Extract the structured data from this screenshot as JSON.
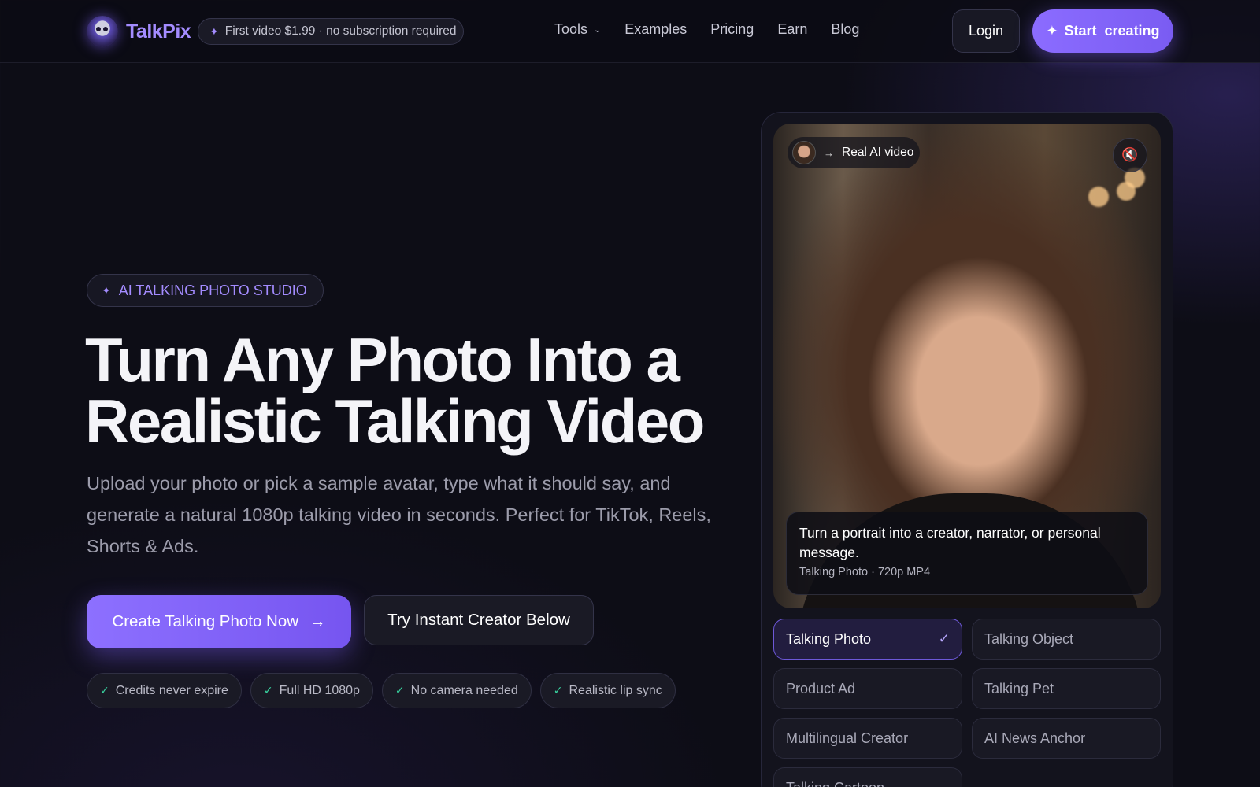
{
  "nav": {
    "brand": "TalkPix",
    "promo": "First video $1.99 · no subscription required",
    "menu": [
      {
        "label": "Tools"
      },
      {
        "label": "Examples"
      },
      {
        "label": "Pricing"
      },
      {
        "label": "Earn"
      },
      {
        "label": "Blog"
      }
    ],
    "login_label": "Login",
    "start_label": "Start  creating"
  },
  "hero": {
    "eyebrow": "AI TALKING PHOTO STUDIO",
    "title_line1": "Turn Any Photo Into a",
    "title_line2": "Realistic Talking Video",
    "subtitle": "Upload your photo or pick a sample avatar, type what it should say, and generate a natural 1080p talking video in seconds. Perfect for TikTok, Reels, Shorts & Ads.",
    "cta_primary": "Create Talking Photo Now",
    "cta_secondary": "Try Instant Creator Below",
    "features": [
      "Credits never expire",
      "Full HD 1080p",
      "No camera needed",
      "Realistic lip sync"
    ]
  },
  "preview": {
    "tag": "Real AI video",
    "caption": "Turn a portrait into a creator, narrator, or personal message.",
    "meta": "Talking Photo · 720p MP4",
    "options": [
      {
        "label": "Talking Photo",
        "selected": true
      },
      {
        "label": "Talking Object",
        "selected": false
      },
      {
        "label": "Product Ad",
        "selected": false
      },
      {
        "label": "Talking Pet",
        "selected": false
      },
      {
        "label": "Multilingual Creator",
        "selected": false
      },
      {
        "label": "AI News Anchor",
        "selected": false
      },
      {
        "label": "Talking Cartoon",
        "selected": false
      }
    ]
  },
  "theme": {
    "accent": "#8b6cff",
    "background": "#0d0d16",
    "success": "#38d39f"
  }
}
